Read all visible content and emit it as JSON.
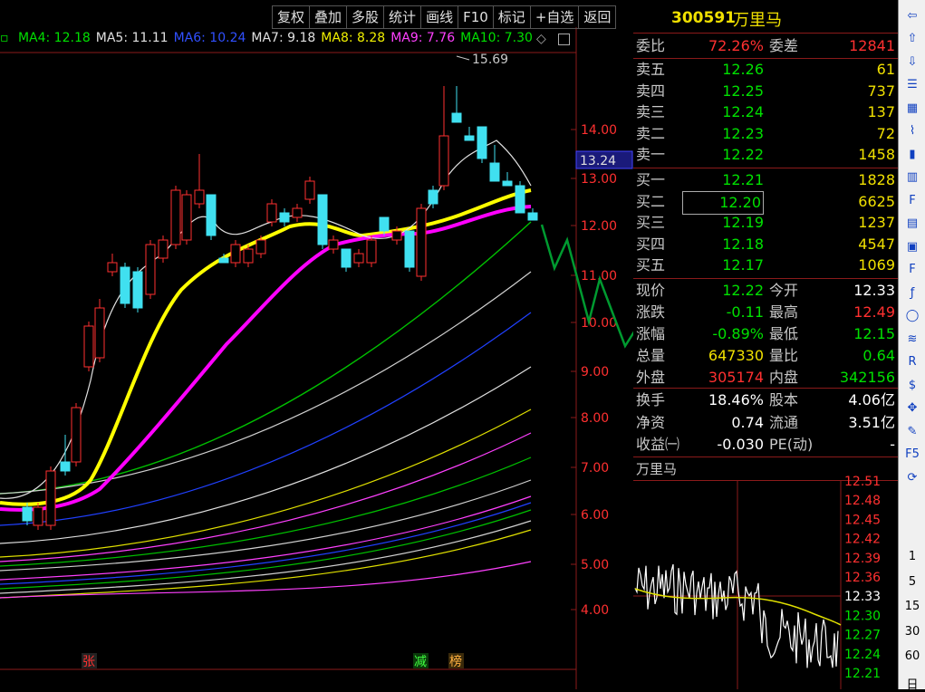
{
  "toolbar": {
    "items": [
      "复权",
      "叠加",
      "多股",
      "统计",
      "画线",
      "F10",
      "标记",
      "+自选",
      "返回"
    ]
  },
  "ma_legend": [
    {
      "label": "MA4: 12.18",
      "color": "#00e000"
    },
    {
      "label": "MA5: 11.11",
      "color": "#e0e0e0"
    },
    {
      "label": "MA6: 10.24",
      "color": "#3050ff"
    },
    {
      "label": "MA7: 9.18",
      "color": "#e0e0e0"
    },
    {
      "label": "MA8: 8.28",
      "color": "#f0f000"
    },
    {
      "label": "MA9: 7.76",
      "color": "#ff40ff"
    },
    {
      "label": "MA10: 7.30",
      "color": "#00e000"
    }
  ],
  "main_chart": {
    "price_axis": [
      "14.00",
      "13.00",
      "12.00",
      "11.00",
      "10.00",
      "9.00",
      "8.00",
      "7.00",
      "6.00",
      "5.00",
      "4.00"
    ],
    "current_price_marker": "13.24",
    "high_annotation": "15.69",
    "markers": {
      "zhang": "张",
      "jian": "减",
      "bang": "榜"
    }
  },
  "quote": {
    "code": "300591",
    "name": "万里马",
    "weibi_label": "委比",
    "weibi_value": "72.26%",
    "weicha_label": "委差",
    "weicha_value": "12841",
    "sell": [
      {
        "label": "卖五",
        "price": "12.26",
        "vol": "61"
      },
      {
        "label": "卖四",
        "price": "12.25",
        "vol": "737"
      },
      {
        "label": "卖三",
        "price": "12.24",
        "vol": "137"
      },
      {
        "label": "卖二",
        "price": "12.23",
        "vol": "72"
      },
      {
        "label": "卖一",
        "price": "12.22",
        "vol": "1458"
      }
    ],
    "buy": [
      {
        "label": "买一",
        "price": "12.21",
        "vol": "1828"
      },
      {
        "label": "买二",
        "price": "12.20",
        "vol": "6625"
      },
      {
        "label": "买三",
        "price": "12.19",
        "vol": "1237"
      },
      {
        "label": "买四",
        "price": "12.18",
        "vol": "4547"
      },
      {
        "label": "买五",
        "price": "12.17",
        "vol": "1069"
      }
    ],
    "stats": [
      {
        "l1": "现价",
        "v1": "12.22",
        "c1": "#00e000",
        "l2": "今开",
        "v2": "12.33",
        "c2": "#ffffff"
      },
      {
        "l1": "涨跌",
        "v1": "-0.11",
        "c1": "#00e000",
        "l2": "最高",
        "v2": "12.49",
        "c2": "#ff3030"
      },
      {
        "l1": "涨幅",
        "v1": "-0.89%",
        "c1": "#00e000",
        "l2": "最低",
        "v2": "12.15",
        "c2": "#00e000"
      },
      {
        "l1": "总量",
        "v1": "647330",
        "c1": "#f0e000",
        "l2": "量比",
        "v2": "0.64",
        "c2": "#00e000"
      },
      {
        "l1": "外盘",
        "v1": "305174",
        "c1": "#ff3030",
        "l2": "内盘",
        "v2": "342156",
        "c2": "#00e000"
      }
    ],
    "fund": [
      {
        "l1": "换手",
        "v1": "18.46%",
        "l2": "股本",
        "v2": "4.06亿"
      },
      {
        "l1": "净资",
        "v1": "0.74",
        "l2": "流通",
        "v2": "3.51亿"
      },
      {
        "l1": "收益㈠",
        "v1": "-0.030",
        "l2": "PE(动)",
        "v2": "-"
      }
    ]
  },
  "mini_chart": {
    "title": "万里马",
    "axis": [
      "12.51",
      "12.48",
      "12.45",
      "12.42",
      "12.39",
      "12.36",
      "12.33",
      "12.30",
      "12.27",
      "12.24",
      "12.21"
    ]
  },
  "sidebar": {
    "labels": [
      "1",
      "5",
      "15",
      "30",
      "60",
      "日"
    ]
  }
}
